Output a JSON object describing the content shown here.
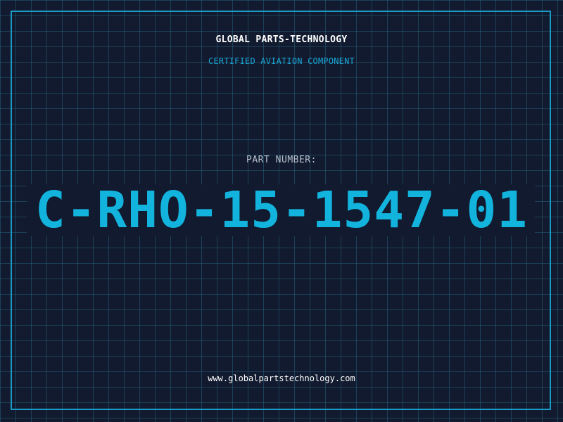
{
  "header": {
    "company": "GLOBAL PARTS-TECHNOLOGY",
    "subtitle": "CERTIFIED AVIATION COMPONENT"
  },
  "part": {
    "label": "PART NUMBER:",
    "number": "C-RHO-15-1547-01"
  },
  "footer": {
    "url": "www.globalpartstechnology.com"
  },
  "colors": {
    "background": "#111a2e",
    "grid": "#266078",
    "frame": "#1a9ac4",
    "accent": "#12b4de",
    "text": "#ffffff"
  }
}
